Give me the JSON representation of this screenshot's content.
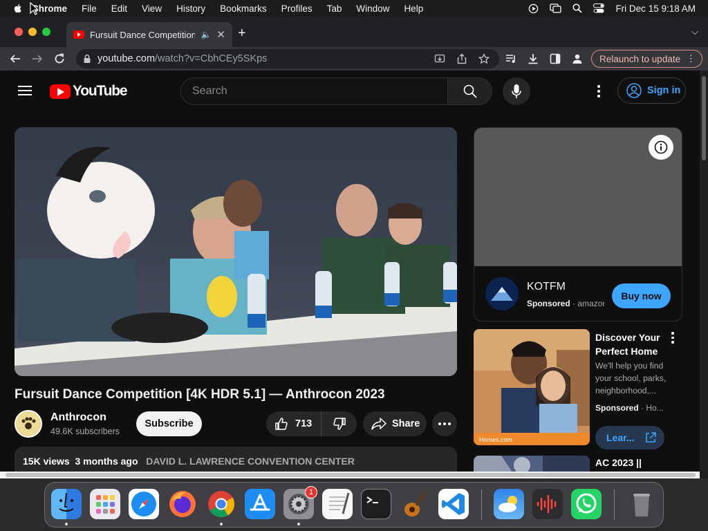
{
  "menubar": {
    "app": "Chrome",
    "items": [
      "File",
      "Edit",
      "View",
      "History",
      "Bookmarks",
      "Profiles",
      "Tab",
      "Window",
      "Help"
    ],
    "datetime": "Fri Dec 15  9:18 AM"
  },
  "browser": {
    "tab_title": "Fursuit Dance Competition [4K HDR 5.1] — Anthrocon 2023",
    "url_host": "youtube.com",
    "url_path": "/watch?v=CbhCEy5SKps",
    "relaunch_label": "Relaunch to update"
  },
  "youtube": {
    "logo_text": "YouTube",
    "search_placeholder": "Search",
    "signin_label": "Sign in",
    "video": {
      "title": "Fursuit Dance Competition [4K HDR 5.1] — Anthrocon 2023",
      "channel": "Anthrocon",
      "subscribers": "49.6K subscribers",
      "subscribe_label": "Subscribe",
      "likes": "713",
      "share_label": "Share",
      "views": "15K views",
      "age": "3 months ago",
      "location": "DAVID L. LAWRENCE CONVENTION CENTER",
      "avatar_text": "Anthrocon"
    },
    "ad": {
      "name": "KOTFM",
      "sponsored": "Sponsored",
      "source": "amazon",
      "cta": "Buy now"
    },
    "promo": {
      "title": "Discover Your Perfect Home",
      "description": "We'll help you find your school, parks, neighborhood,...",
      "sponsored": "Sponsored",
      "source": "Ho...",
      "cta": "Lear...",
      "thumb_brand": "Homes.com"
    },
    "next_video": {
      "title": "AC 2023 ||"
    }
  },
  "dock": {
    "apps": [
      "Finder",
      "Launchpad",
      "Safari",
      "Firefox",
      "Chrome",
      "App Store",
      "System Settings",
      "TextEdit",
      "Terminal",
      "GarageBand",
      "Visual Studio Code",
      "Weather",
      "Voice Memos",
      "WhatsApp",
      "Trash"
    ],
    "settings_badge": "1"
  },
  "colors": {
    "yt_bg": "#0f0f0f",
    "yt_red": "#ff0000",
    "link_blue": "#3ea6ff",
    "chrome_toolbar": "#35363a"
  }
}
